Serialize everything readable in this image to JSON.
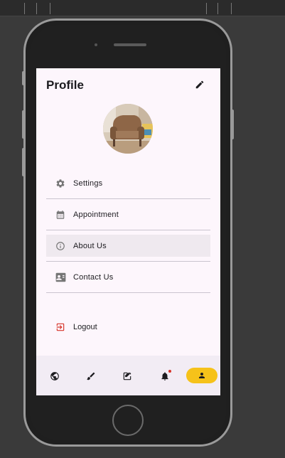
{
  "profile": {
    "title": "Profile"
  },
  "menu": {
    "items": [
      {
        "label": "Settings",
        "icon": "gear-icon"
      },
      {
        "label": "Appointment",
        "icon": "calendar-icon"
      },
      {
        "label": "About Us",
        "icon": "info-icon"
      },
      {
        "label": "Contact Us",
        "icon": "contact-card-icon"
      }
    ],
    "logout_label": "Logout"
  },
  "bottom_nav": [
    "globe-icon",
    "brush-icon",
    "edit-square-icon",
    "bell-icon",
    "person-icon"
  ],
  "colors": {
    "accent": "#f6c21a",
    "logout": "#d6342a",
    "screen_bg": "#fdf6fc"
  }
}
